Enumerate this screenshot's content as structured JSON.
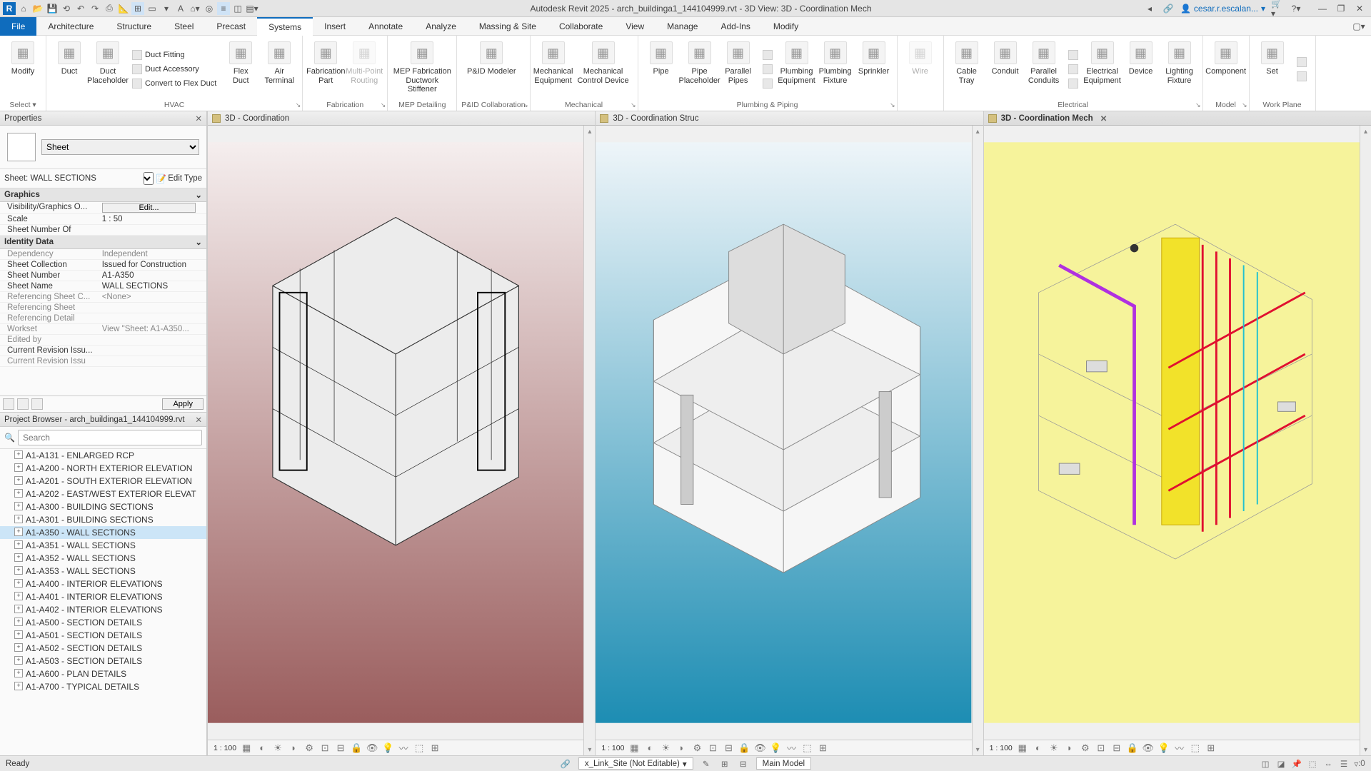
{
  "titlebar": {
    "title": "Autodesk Revit 2025 - arch_buildinga1_144104999.rvt - 3D View: 3D - Coordination Mech",
    "user": "cesar.r.escalan..."
  },
  "tabs": {
    "file": "File",
    "items": [
      "Architecture",
      "Structure",
      "Steel",
      "Precast",
      "Systems",
      "Insert",
      "Annotate",
      "Analyze",
      "Massing & Site",
      "Collaborate",
      "View",
      "Manage",
      "Add-Ins",
      "Modify"
    ],
    "active_index": 4
  },
  "ribbon": {
    "groups": [
      {
        "label": "Select ▾",
        "expand": false,
        "buttons": [
          {
            "label": "Modify",
            "large": true
          }
        ]
      },
      {
        "label": "HVAC",
        "expand": true,
        "buttons": [
          {
            "label": "Duct",
            "large": true
          },
          {
            "label": "Duct\nPlaceholder",
            "large": true
          },
          {
            "stack": [
              "Duct Fitting",
              "Duct Accessory",
              "Convert to  Flex Duct"
            ]
          },
          {
            "label": "Flex\nDuct",
            "large": true
          },
          {
            "label": "Air\nTerminal",
            "large": true
          }
        ]
      },
      {
        "label": "Fabrication",
        "expand": true,
        "buttons": [
          {
            "label": "Fabrication\nPart",
            "large": true
          },
          {
            "label": "Multi-Point\nRouting",
            "large": true,
            "disabled": true
          }
        ]
      },
      {
        "label": "MEP Detailing",
        "buttons": [
          {
            "label": "MEP Fabrication\nDuctwork Stiffener",
            "large": true,
            "wide": true
          }
        ]
      },
      {
        "label": "P&ID Collaboration",
        "expand": true,
        "buttons": [
          {
            "label": "P&ID Modeler",
            "large": true,
            "wide": true
          }
        ]
      },
      {
        "label": "Mechanical",
        "expand": true,
        "buttons": [
          {
            "label": "Mechanical\nEquipment",
            "large": true
          },
          {
            "label": "Mechanical\nControl Device",
            "large": true,
            "wide": true
          }
        ]
      },
      {
        "label": "Plumbing & Piping",
        "expand": true,
        "buttons": [
          {
            "label": "Pipe",
            "large": true
          },
          {
            "label": "Pipe\nPlaceholder",
            "large": true
          },
          {
            "label": "Parallel\nPipes",
            "large": true
          },
          {
            "stack_icons": 3
          },
          {
            "label": "Plumbing\nEquipment",
            "large": true
          },
          {
            "label": "Plumbing\nFixture",
            "large": true
          },
          {
            "label": "Sprinkler",
            "large": true
          }
        ]
      },
      {
        "label": " ",
        "buttons": [
          {
            "label": "Wire",
            "large": true,
            "disabled": true
          }
        ]
      },
      {
        "label": "Electrical",
        "expand": true,
        "buttons": [
          {
            "label": "Cable\nTray",
            "large": true
          },
          {
            "label": "Conduit",
            "large": true
          },
          {
            "label": "Parallel\nConduits",
            "large": true
          },
          {
            "stack_icons": 3
          },
          {
            "label": "Electrical\nEquipment",
            "large": true
          },
          {
            "label": "Device",
            "large": true
          },
          {
            "label": "Lighting\nFixture",
            "large": true
          }
        ]
      },
      {
        "label": "Model",
        "expand": true,
        "buttons": [
          {
            "label": "Component",
            "large": true
          }
        ]
      },
      {
        "label": "Work Plane",
        "buttons": [
          {
            "label": "Set",
            "large": true
          },
          {
            "stack_icons": 2
          }
        ]
      }
    ]
  },
  "properties": {
    "panel_title": "Properties",
    "type_selector": "Sheet",
    "sheet_instance": "Sheet: WALL SECTIONS",
    "edit_type": "Edit Type",
    "categories": [
      {
        "name": "Graphics",
        "rows": [
          {
            "n": "Visibility/Graphics O...",
            "v": "Edit...",
            "btn": true
          },
          {
            "n": "Scale",
            "v": "1 : 50"
          },
          {
            "n": "Sheet Number Of",
            "v": ""
          }
        ]
      },
      {
        "name": "Identity Data",
        "rows": [
          {
            "n": "Dependency",
            "v": "Independent",
            "dim": true
          },
          {
            "n": "Sheet Collection",
            "v": "Issued for Construction"
          },
          {
            "n": "Sheet Number",
            "v": "A1-A350"
          },
          {
            "n": "Sheet Name",
            "v": "WALL SECTIONS"
          },
          {
            "n": "Referencing Sheet C...",
            "v": "<None>",
            "dim": true
          },
          {
            "n": "Referencing Sheet",
            "v": "",
            "dim": true
          },
          {
            "n": "Referencing Detail",
            "v": "",
            "dim": true
          },
          {
            "n": "Workset",
            "v": "View \"Sheet: A1-A350...",
            "dim": true
          },
          {
            "n": "Edited by",
            "v": "",
            "dim": true
          },
          {
            "n": "Current Revision Issu...",
            "v": ""
          },
          {
            "n": "Current Revision Issu",
            "v": "",
            "dim": true
          }
        ]
      }
    ],
    "apply": "Apply"
  },
  "browser": {
    "panel_title": "Project Browser - arch_buildinga1_144104999.rvt",
    "search_placeholder": "Search",
    "items": [
      "A1-A131 - ENLARGED RCP",
      "A1-A200 - NORTH EXTERIOR ELEVATION",
      "A1-A201 - SOUTH EXTERIOR ELEVATION",
      "A1-A202 - EAST/WEST EXTERIOR ELEVAT",
      "A1-A300 - BUILDING SECTIONS",
      "A1-A301 - BUILDING SECTIONS",
      "A1-A350 - WALL SECTIONS",
      "A1-A351 - WALL SECTIONS",
      "A1-A352 - WALL SECTIONS",
      "A1-A353 - WALL SECTIONS",
      "A1-A400 - INTERIOR ELEVATIONS",
      "A1-A401 - INTERIOR ELEVATIONS",
      "A1-A402 - INTERIOR ELEVATIONS",
      "A1-A500 - SECTION DETAILS",
      "A1-A501 - SECTION DETAILS",
      "A1-A502 - SECTION DETAILS",
      "A1-A503 - SECTION DETAILS",
      "A1-A600 - PLAN DETAILS",
      "A1-A700 - TYPICAL DETAILS"
    ],
    "selected_index": 6
  },
  "views": [
    {
      "title": "3D - Coordination",
      "scale": "1 : 100",
      "active": false,
      "closable": false
    },
    {
      "title": "3D - Coordination Struc",
      "scale": "1 : 100",
      "active": false,
      "closable": false
    },
    {
      "title": "3D - Coordination Mech",
      "scale": "1 : 100",
      "active": true,
      "closable": true
    }
  ],
  "statusbar": {
    "ready": "Ready",
    "workset": "x_Link_Site (Not Editable)",
    "model": "Main Model",
    "filter_count": ":0"
  }
}
